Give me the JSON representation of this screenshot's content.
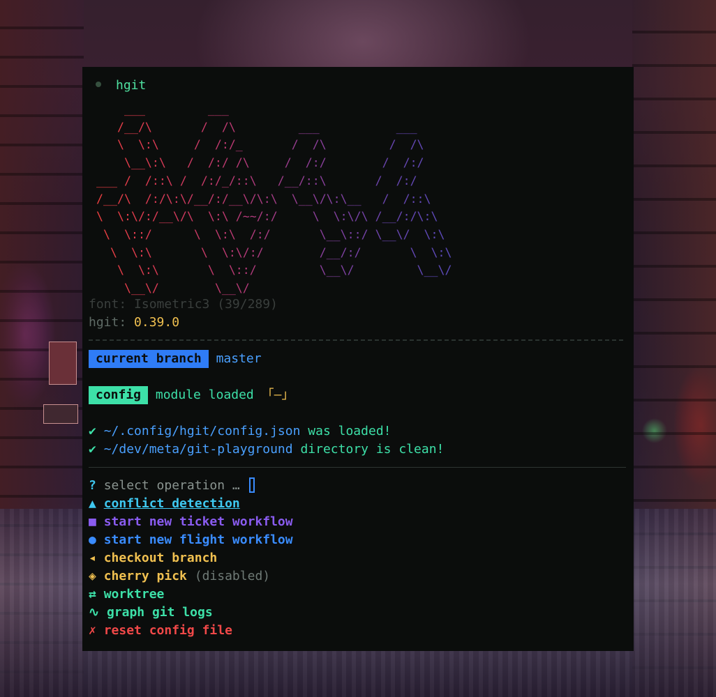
{
  "window": {
    "title": "hgit"
  },
  "banner": {
    "ascii_lines": [
      "    ___         ___                               ",
      "   /__/\\       /  /\\         ___           ___    ",
      "   \\  \\:\\     /  /:/_       /  /\\         /  /\\   ",
      "    \\__\\:\\   /  /:/ /\\     /  /:/        /  /:/   ",
      "___ /  /::\\ /  /:/_/::\\   /__/::\\       /  /:/    ",
      "/__/\\  /:/\\:\\/__/:/__\\/\\:\\  \\__\\/\\:\\__   /  /::\\    ",
      "\\  \\:\\/:/__\\/\\  \\:\\ /~~/:/     \\  \\:\\/\\ /__/:/\\:\\   ",
      " \\  \\::/      \\  \\:\\  /:/       \\__\\::/ \\__\\/  \\:\\  ",
      "  \\  \\:\\       \\  \\:\\/:/        /__/:/       \\  \\:\\ ",
      "   \\  \\:\\       \\  \\::/         \\__\\/         \\__\\/ ",
      "    \\__\\/        \\__\\/                              "
    ],
    "gradient_colors": [
      "#f04040",
      "#d83a5a",
      "#b83a78",
      "#8e3f9a",
      "#6a45b0",
      "#5a4cc0"
    ],
    "font_label": "font: Isometric3 (39/289)",
    "version_key": "hgit:",
    "version_value": "0.39.0"
  },
  "branch": {
    "label": "current branch",
    "value": "master"
  },
  "config": {
    "label": "config",
    "text": "module loaded",
    "glyph": "「–」"
  },
  "checks": [
    {
      "icon": "✔",
      "path": "~/.config/hgit/config.json",
      "text": " was loaded!"
    },
    {
      "icon": "✔",
      "path": "~/dev/meta/git-playground",
      "text": " directory is clean!"
    }
  ],
  "prompt": {
    "icon": "?",
    "text": "select operation …"
  },
  "menu": [
    {
      "icon": "▲",
      "label": "conflict detection",
      "color": "#3ec8f0"
    },
    {
      "icon": "■",
      "label": "start new ticket workflow",
      "color": "#8a5cf0"
    },
    {
      "icon": "●",
      "label": "start new flight workflow",
      "color": "#3a8cff"
    },
    {
      "icon": "◂",
      "label": "checkout branch",
      "color": "#f0c050"
    },
    {
      "icon": "◈",
      "label": "cherry pick",
      "suffix": "(disabled)",
      "color": "#f0c050"
    },
    {
      "icon": "⇄",
      "label": "worktree",
      "color": "#3de0a8"
    },
    {
      "icon": "∿",
      "label": "graph git logs",
      "color": "#3de0a8"
    },
    {
      "icon": "✗",
      "label": "reset config file",
      "color": "#f04848"
    }
  ],
  "colors": {
    "branch_label_bg": "#2f7cf6",
    "config_label_bg": "#3de0a8",
    "check_color": "#3de0a8"
  }
}
